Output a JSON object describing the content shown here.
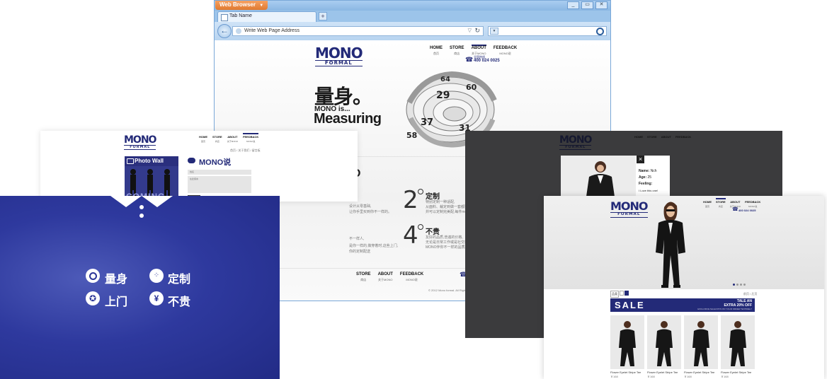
{
  "browser": {
    "app_menu": "Web Browser",
    "tab_title": "Tab Name",
    "new_tab": "+",
    "address_placeholder": "Write Web Page Address"
  },
  "site": {
    "logo": "MONO",
    "logo_sub": "FORMAL",
    "nav": [
      {
        "label": "HOME",
        "sub": "首页"
      },
      {
        "label": "STORE",
        "sub": "商店"
      },
      {
        "label": "ABOUT",
        "sub": "关于MONO"
      },
      {
        "label": "FEEDBACK",
        "sub": "MONO说"
      }
    ],
    "phone_label": "全国热线",
    "phone": "400 024 0025",
    "hero_title": "量身。",
    "hero_sub1": "MONO is...",
    "hero_sub2": "Measuring",
    "features": [
      {
        "num": "2",
        "title": "定制",
        "text1": "特别定制一种适配,",
        "text2": "从面料、裁定到做一套都独特精工设计",
        "text3": "并可以定制完美配,每件mono都不拘一格"
      },
      {
        "num": "4",
        "title": "不贵",
        "text1": "友好的品质,普遍的价格,",
        "text2": "无论是日常工作或是社交场合,都是最好",
        "text3": "MONO伴你不一样的品质。"
      }
    ],
    "left_col_text": [
      "设计从零基础,",
      "让你手里买到你不一样的。",
      "不一样人,",
      "是你一样的,做穿着时,这些上门,",
      "你的定制配送"
    ],
    "copyright": "© 2012 Mono formal. All Rights Reserved."
  },
  "feedback_page": {
    "breadcrumb": "首页 / 关于我们 / 留言板",
    "photo_wall": "Photo Wall",
    "coming": "COMING",
    "mono_say": "MONO说",
    "name_hint": "姓名",
    "message_hint": "在此留言",
    "submit": ""
  },
  "blue_panel": {
    "items": [
      "量身",
      "定制",
      "上门",
      "不贵"
    ]
  },
  "profile_popup": {
    "name_label": "Name:",
    "name_value": "Nch",
    "age_label": "Age:",
    "age_value": "25",
    "feeling_label": "Feeling:",
    "feeling_value": "I Love this one!",
    "close": "×",
    "heading_partial": "说"
  },
  "store_page": {
    "filter_label": "品类",
    "sale_title": "SALE",
    "tale_an": "TALE AN",
    "extra": "EXTRA 20% OFF",
    "sale_note": "EXCLUSIVE SALE PAYS ON YOUR ORDER *ENTIRELY",
    "pager_text": "前页 / 后页",
    "products": [
      {
        "name": "Flower Eyelet Stripe Tee",
        "price": "￥168"
      },
      {
        "name": "Flower Eyelet Stripe Tee",
        "price": "￥168"
      },
      {
        "name": "Flower Eyelet Stripe Tee",
        "price": "￥168"
      },
      {
        "name": "Flower Eyelet Stripe Tee",
        "price": "￥168"
      }
    ]
  },
  "colors": {
    "brand_navy": "#232a78",
    "browser_blue": "#8dbce8",
    "dark_gray": "#3a3a3c",
    "blue_panel": "#2a3498"
  }
}
